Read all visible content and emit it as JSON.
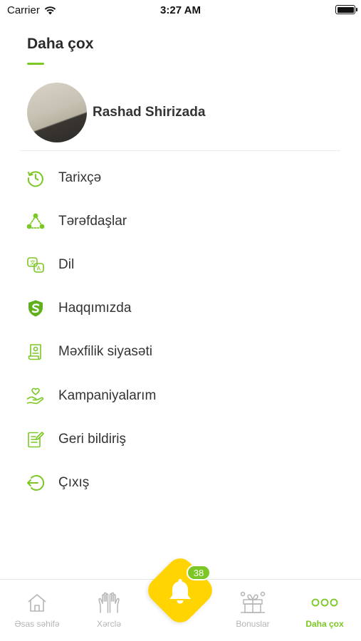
{
  "status_bar": {
    "carrier": "Carrier",
    "time": "3:27 AM"
  },
  "header": {
    "title": "Daha çox"
  },
  "profile": {
    "name": "Rashad Shirizada"
  },
  "menu": {
    "items": [
      {
        "label": "Tarixçə",
        "icon": "history-icon"
      },
      {
        "label": "Tərəfdaşlar",
        "icon": "partners-icon"
      },
      {
        "label": "Dil",
        "icon": "language-icon"
      },
      {
        "label": "Haqqımızda",
        "icon": "about-shield-icon"
      },
      {
        "label": "Məxfilik siyasəti",
        "icon": "privacy-document-icon"
      },
      {
        "label": "Kampaniyalarım",
        "icon": "campaign-hand-heart-icon"
      },
      {
        "label": "Geri bildiriş",
        "icon": "feedback-icon"
      },
      {
        "label": "Çıxış",
        "icon": "logout-icon"
      }
    ]
  },
  "tab_bar": {
    "tabs": [
      {
        "label": "Əsas səhifə",
        "icon": "home-icon"
      },
      {
        "label": "Xərclə",
        "icon": "spend-hands-icon"
      },
      {
        "label": "Bonuslar",
        "icon": "bonus-gift-icon"
      },
      {
        "label": "Daha çox",
        "icon": "more-dots-icon"
      }
    ],
    "active": "Daha çox"
  },
  "notifications": {
    "count": "38"
  },
  "colors": {
    "accent": "#7bc724",
    "bell_bg": "#ffd400",
    "text": "#333333",
    "inactive": "#b5b5b5"
  }
}
